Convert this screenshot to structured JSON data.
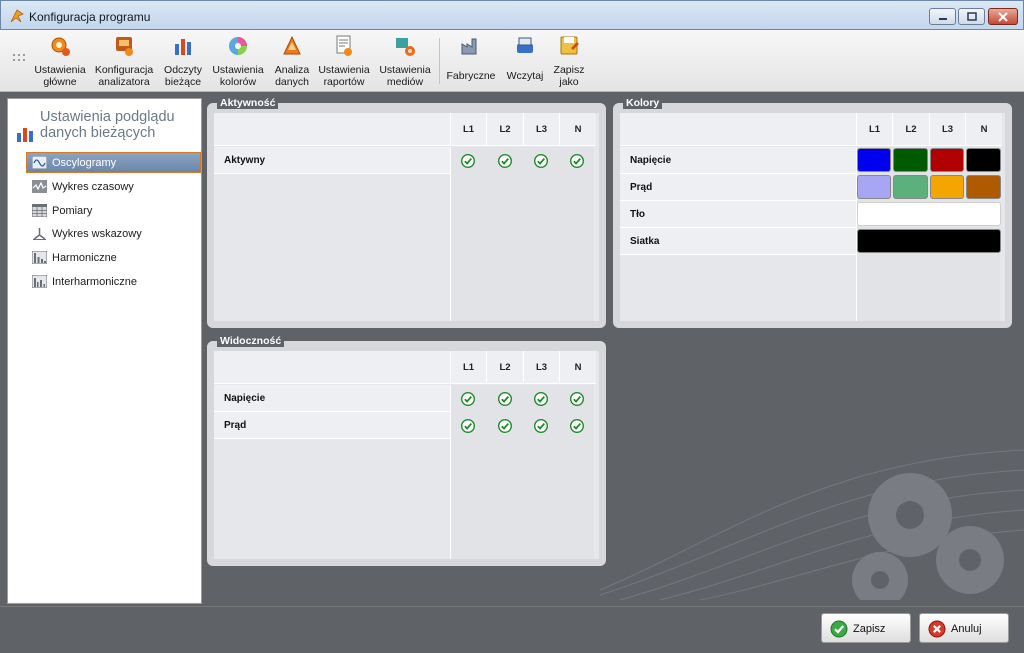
{
  "window": {
    "title": "Konfiguracja programu"
  },
  "toolbar": {
    "items": [
      {
        "line1": "Ustawienia",
        "line2": "główne",
        "icon": "gear-icon"
      },
      {
        "line1": "Konfiguracja",
        "line2": "analizatora",
        "icon": "analyzer-icon"
      },
      {
        "line1": "Odczyty",
        "line2": "bieżące",
        "icon": "bar-chart-icon"
      },
      {
        "line1": "Ustawienia",
        "line2": "kolorów",
        "icon": "color-wheel-icon"
      },
      {
        "line1": "Analiza",
        "line2": "danych",
        "icon": "analysis-icon"
      },
      {
        "line1": "Ustawienia",
        "line2": "raportów",
        "icon": "report-icon"
      },
      {
        "line1": "Ustawienia",
        "line2": "mediów",
        "icon": "media-icon"
      },
      {
        "line1": "Fabryczne",
        "line2": "",
        "icon": "factory-icon"
      },
      {
        "line1": "Wczytaj",
        "line2": "",
        "icon": "load-icon"
      },
      {
        "line1": "Zapisz",
        "line2": "jako",
        "icon": "save-as-icon"
      }
    ]
  },
  "sidebar": {
    "heading": "Ustawienia podglądu danych bieżących",
    "items": [
      {
        "label": "Oscylogramy",
        "icon": "waveform-icon",
        "active": true
      },
      {
        "label": "Wykres czasowy",
        "icon": "time-chart-icon",
        "active": false
      },
      {
        "label": "Pomiary",
        "icon": "table-icon",
        "active": false
      },
      {
        "label": "Wykres wskazowy",
        "icon": "phasor-icon",
        "active": false
      },
      {
        "label": "Harmoniczne",
        "icon": "harmonics-icon",
        "active": false
      },
      {
        "label": "Interharmoniczne",
        "icon": "interharmonics-icon",
        "active": false
      }
    ]
  },
  "activity": {
    "title": "Aktywność",
    "columns": [
      "L1",
      "L2",
      "L3",
      "N"
    ],
    "rows": [
      {
        "label": "Aktywny",
        "checked": [
          true,
          true,
          true,
          true
        ]
      }
    ]
  },
  "visibility": {
    "title": "Widoczność",
    "columns": [
      "L1",
      "L2",
      "L3",
      "N"
    ],
    "rows": [
      {
        "label": "Napięcie",
        "checked": [
          true,
          true,
          true,
          true
        ]
      },
      {
        "label": "Prąd",
        "checked": [
          true,
          true,
          true,
          true
        ]
      }
    ]
  },
  "colors": {
    "title": "Kolory",
    "columns": [
      "L1",
      "L2",
      "L3",
      "N"
    ],
    "rows": [
      {
        "label": "Napięcie",
        "colors": [
          "#0000ee",
          "#005a00",
          "#b00000",
          "#000000"
        ]
      },
      {
        "label": "Prąd",
        "colors": [
          "#a6a6f5",
          "#5cb07c",
          "#f5a500",
          "#b05a00"
        ]
      },
      {
        "label": "Tło",
        "colors": [
          "#ffffff"
        ]
      },
      {
        "label": "Siatka",
        "colors": [
          "#000000"
        ]
      }
    ]
  },
  "actions": {
    "save_label": "Zapisz",
    "cancel_label": "Anuluj"
  }
}
